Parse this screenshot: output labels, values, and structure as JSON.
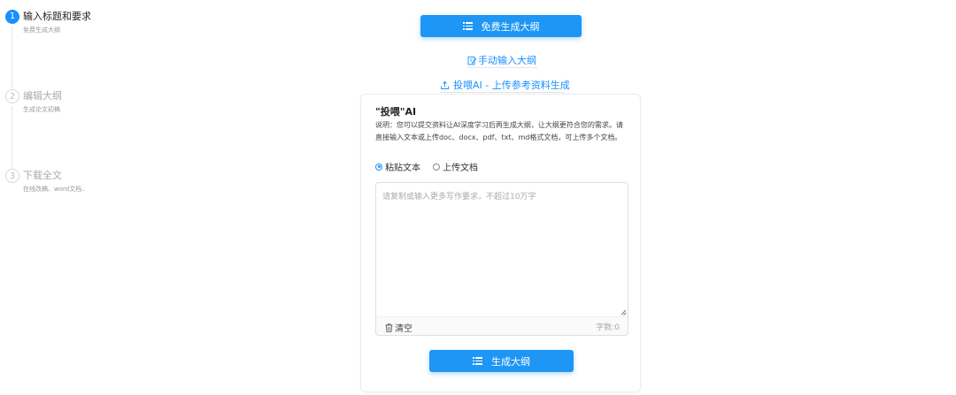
{
  "steps": [
    {
      "num": "1",
      "title": "输入标题和要求",
      "desc": "免费生成大纲"
    },
    {
      "num": "2",
      "title": "编辑大纲",
      "desc": "生成论文初稿"
    },
    {
      "num": "3",
      "title": "下载全文",
      "desc": "在线改稿、word文档.."
    }
  ],
  "top": {
    "generate_free_label": "免费生成大纲",
    "manual_label": "手动输入大纲",
    "feed_ai_label": "投喂AI - 上传参考资料生成"
  },
  "card": {
    "title": "\"投喂\"AI",
    "desc": "说明：您可以提交资料让AI深度学习后再生成大纲，让大纲更符合您的需求。请直接输入文本或上传doc、docx、pdf、txt、md格式文档，可上传多个文档。",
    "radio_paste": "粘贴文本",
    "radio_upload": "上传文档",
    "textarea_placeholder": "请复制或输入更多写作要求，不超过10万字",
    "clear_label": "清空",
    "word_count": "字数:0",
    "generate_label": "生成大纲"
  },
  "colors": {
    "accent": "#1e96f5",
    "link": "#1890ff"
  },
  "icons": [
    "list-icon",
    "edit-icon",
    "upload-icon",
    "trash-icon"
  ]
}
